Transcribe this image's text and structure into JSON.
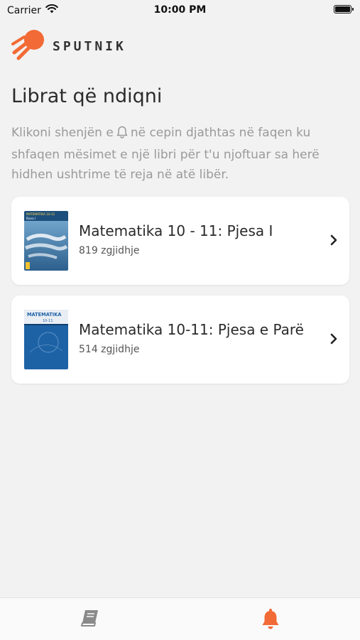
{
  "status_bar": {
    "carrier": "Carrier",
    "time": "10:00 PM"
  },
  "brand": {
    "name": "SPUTNIK",
    "accent": "#f26a35"
  },
  "page": {
    "title": "Librat që ndiqni",
    "hint_before": "Klikoni shenjën e",
    "hint_after": "në cepin djathtas në faqen ku shfaqen mësimet e një libri për t'u njoftuar sa herë hidhen ushtrime të reja në atë libër."
  },
  "books": [
    {
      "title": "Matematika 10 - 11: Pjesa I",
      "count": "819 zgjidhje",
      "cover_label": "MATEMATIKA 10-11",
      "cover_sub": "Pjesa I"
    },
    {
      "title": "Matematika 10-11: Pjesa e Parë",
      "count": "514 zgjidhje",
      "cover_label": "MATEMATIKA",
      "cover_sub": "10-11"
    }
  ],
  "tabs": [
    {
      "icon": "book-icon",
      "active": false
    },
    {
      "icon": "bell-icon",
      "active": true
    }
  ]
}
